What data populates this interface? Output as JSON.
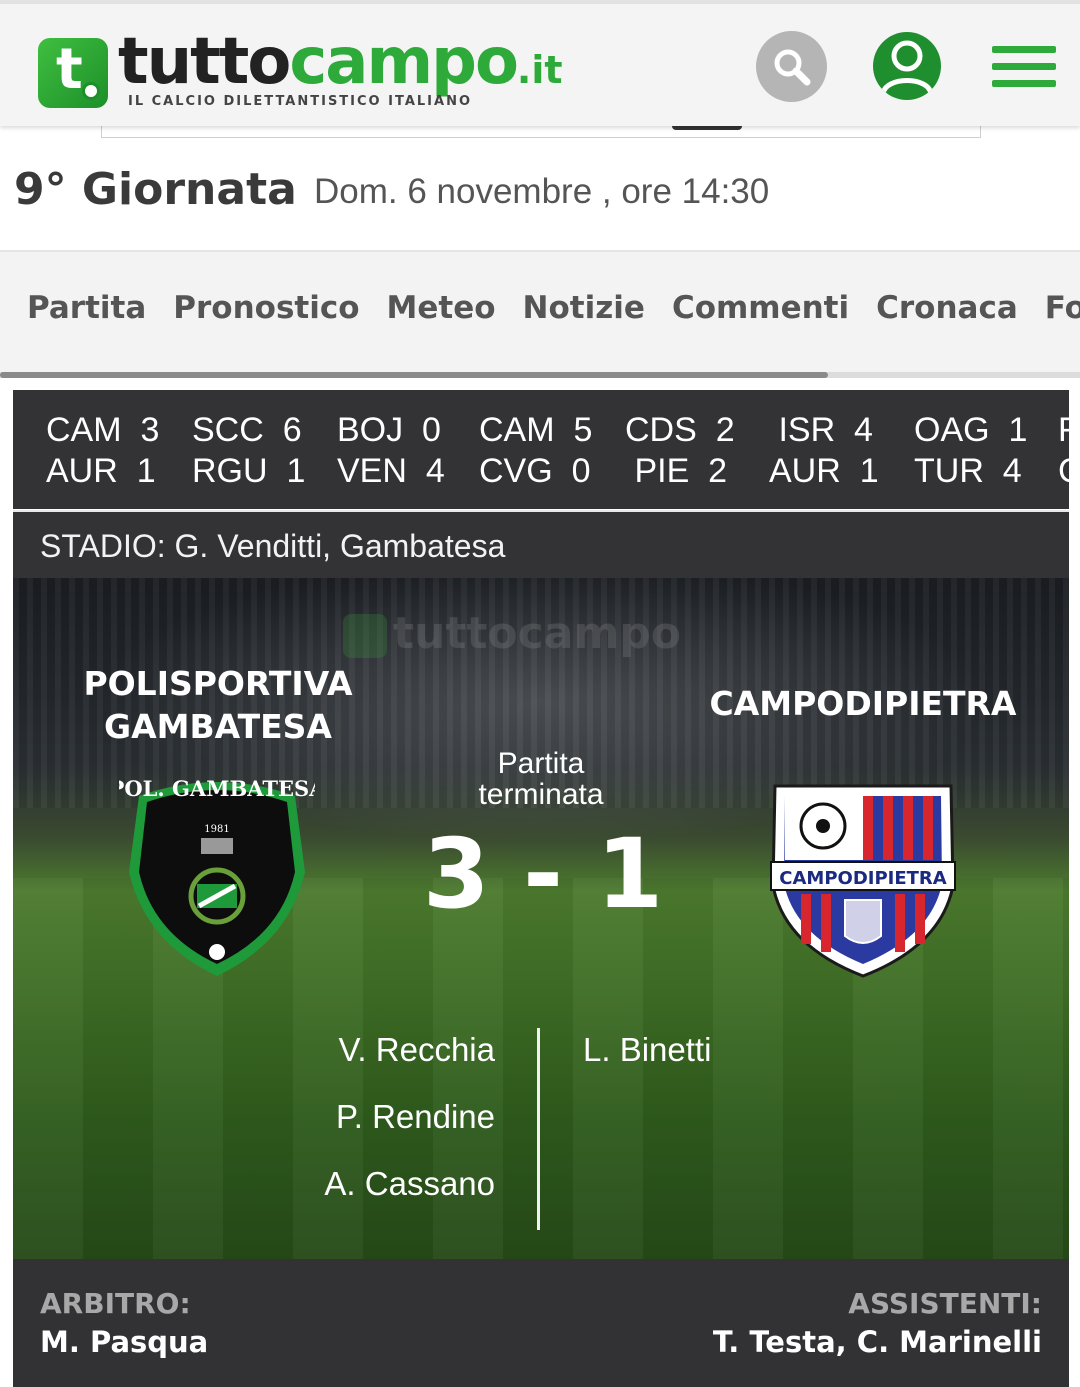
{
  "header": {
    "logo_name": "tutto",
    "logo_brand": "campo",
    "logo_suffix": ".it",
    "logo_tagline": "IL CALCIO DILETTANTISTICO ITALIANO",
    "icons": {
      "search": "search-icon",
      "user": "user-icon",
      "menu": "hamburger-menu-icon"
    },
    "accent_color": "#2eaa3a"
  },
  "match_info": {
    "round": "9° Giornata",
    "date": "Dom. 6 novembre , ore 14:30"
  },
  "tabs": [
    {
      "label": "Partita"
    },
    {
      "label": "Pronostico"
    },
    {
      "label": "Meteo"
    },
    {
      "label": "Notizie"
    },
    {
      "label": "Commenti"
    },
    {
      "label": "Cronaca"
    },
    {
      "label": "Form"
    }
  ],
  "ticker": [
    {
      "home": "CAM",
      "home_score": "3",
      "away": "AUR",
      "away_score": "1"
    },
    {
      "home": "SCC",
      "home_score": "6",
      "away": "RGU",
      "away_score": "1"
    },
    {
      "home": "BOJ",
      "home_score": "0",
      "away": "VEN",
      "away_score": "4"
    },
    {
      "home": "CAM",
      "home_score": "5",
      "away": "CVG",
      "away_score": "0"
    },
    {
      "home": "CDS",
      "home_score": "2",
      "away": "PIE",
      "away_score": "2"
    },
    {
      "home": "ISR",
      "home_score": "4",
      "away": "AUR",
      "away_score": "1"
    },
    {
      "home": "OAG",
      "home_score": "1",
      "away": "TUR",
      "away_score": "4"
    },
    {
      "home": "F",
      "home_score": "",
      "away": "C",
      "away_score": ""
    }
  ],
  "stadium": "STADIO: G. Venditti, Gambatesa",
  "match": {
    "home_team_line1": "POLISPORTIVA",
    "home_team_line2": "GAMBATESA",
    "away_team": "CAMPODIPIETRA",
    "status_line1": "Partita",
    "status_line2": "terminata",
    "score": "3 - 1",
    "home_crest_text": "POL. GAMBATESA",
    "home_crest_year": "1981",
    "away_crest_text": "CAMPODIPIETRA",
    "home_scorers": [
      "V. Recchia",
      "P. Rendine",
      "A. Cassano"
    ],
    "away_scorers": [
      "L. Binetti"
    ],
    "watermark": "tuttocampo"
  },
  "officials": {
    "referee_label": "ARBITRO:",
    "referee": "M. Pasqua",
    "assistants_label": "ASSISTENTI:",
    "assistants": "T. Testa, C. Marinelli"
  }
}
